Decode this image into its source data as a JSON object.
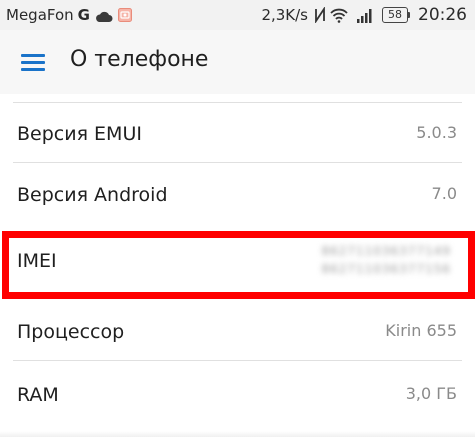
{
  "status_bar": {
    "carrier": "MegaFon",
    "network_type": "G",
    "speed": "2,3K/s",
    "battery_level": "58",
    "time": "20:26",
    "icons": [
      "cloud-icon",
      "photo-notification-icon",
      "nfc-icon",
      "wifi-icon",
      "signal-icon",
      "battery-icon"
    ]
  },
  "toolbar": {
    "title": "О телефоне",
    "menu_icon": "hamburger-menu-icon",
    "accent_color": "#1a73c9"
  },
  "items": [
    {
      "label": "Версия EMUI",
      "value": "5.0.3"
    },
    {
      "label": "Версия Android",
      "value": "7.0"
    },
    {
      "label": "IMEI",
      "values": [
        "862711036377149",
        "862711036377156"
      ]
    },
    {
      "label": "Процессор",
      "value": "Kirin 655"
    },
    {
      "label": "RAM",
      "value": "3,0  ГБ"
    }
  ],
  "highlight_color": "#ff0000"
}
